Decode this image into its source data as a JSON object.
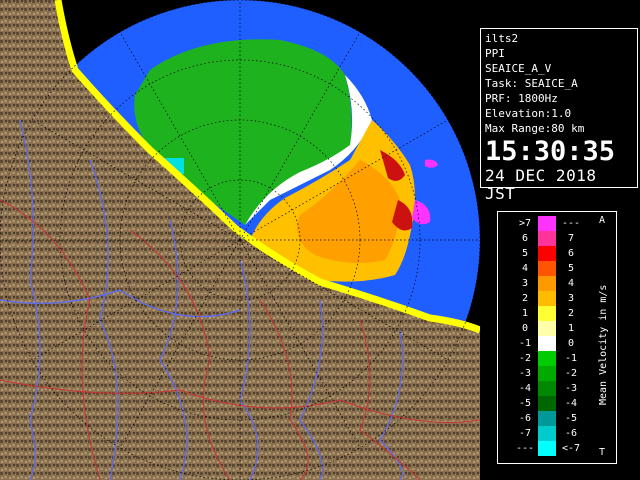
{
  "info": {
    "lines": [
      "ilts2",
      "PPI",
      "SEAICE_A_V",
      "Task: SEAICE_A",
      "PRF: 1800Hz",
      "Elevation:1.0",
      "Max Range:80 km"
    ],
    "time": "15:30:35",
    "date": "24 DEC 2018 JST"
  },
  "legend": {
    "title": "Mean Velocity in m/s",
    "top_marker": "A",
    "bottom_marker": "T",
    "rows": [
      {
        "left": ">7",
        "right": "---",
        "color": "#ff33ff"
      },
      {
        "left": "6",
        "right": "7",
        "color": "#ff3399"
      },
      {
        "left": "5",
        "right": "6",
        "color": "#ff0000"
      },
      {
        "left": "4",
        "right": "5",
        "color": "#ff5500"
      },
      {
        "left": "3",
        "right": "4",
        "color": "#ff9900"
      },
      {
        "left": "2",
        "right": "3",
        "color": "#ffbb00"
      },
      {
        "left": "1",
        "right": "2",
        "color": "#ffff33"
      },
      {
        "left": "0",
        "right": "1",
        "color": "#ffffaa"
      },
      {
        "left": "-1",
        "right": "0",
        "color": "#ffffff"
      },
      {
        "left": "-2",
        "right": "-1",
        "color": "#00cc00"
      },
      {
        "left": "-3",
        "right": "-2",
        "color": "#00aa00"
      },
      {
        "left": "-4",
        "right": "-3",
        "color": "#008800"
      },
      {
        "left": "-5",
        "right": "-4",
        "color": "#006600"
      },
      {
        "left": "-6",
        "right": "-5",
        "color": "#009999"
      },
      {
        "left": "-7",
        "right": "-6",
        "color": "#00cccc"
      },
      {
        "left": "---",
        "right": "<-7",
        "color": "#00ffff"
      }
    ]
  },
  "map": {
    "sea_color": "#1f5fff",
    "land_color": "#8a7150",
    "coast_color": "#ffff00",
    "river_color": "#5a6bff",
    "boundary_color": "#cc3333"
  }
}
